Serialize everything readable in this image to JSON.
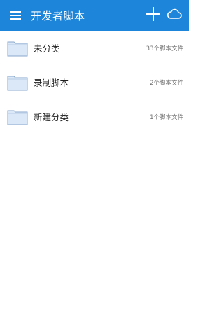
{
  "appbar": {
    "title": "开发者脚本",
    "menu_icon": "hamburger-menu-icon",
    "add_icon": "plus-icon",
    "cloud_icon": "cloud-icon",
    "background": "#1d86db"
  },
  "folders": [
    {
      "label": "未分类",
      "count": "33个脚本文件",
      "icon": "folder-icon"
    },
    {
      "label": "录制脚本",
      "count": "2个脚本文件",
      "icon": "folder-icon"
    },
    {
      "label": "新建分类",
      "count": "1个脚本文件",
      "icon": "folder-icon"
    }
  ],
  "colors": {
    "folder_fill": "#dbe8f7",
    "folder_stroke": "#8aa9cc"
  }
}
